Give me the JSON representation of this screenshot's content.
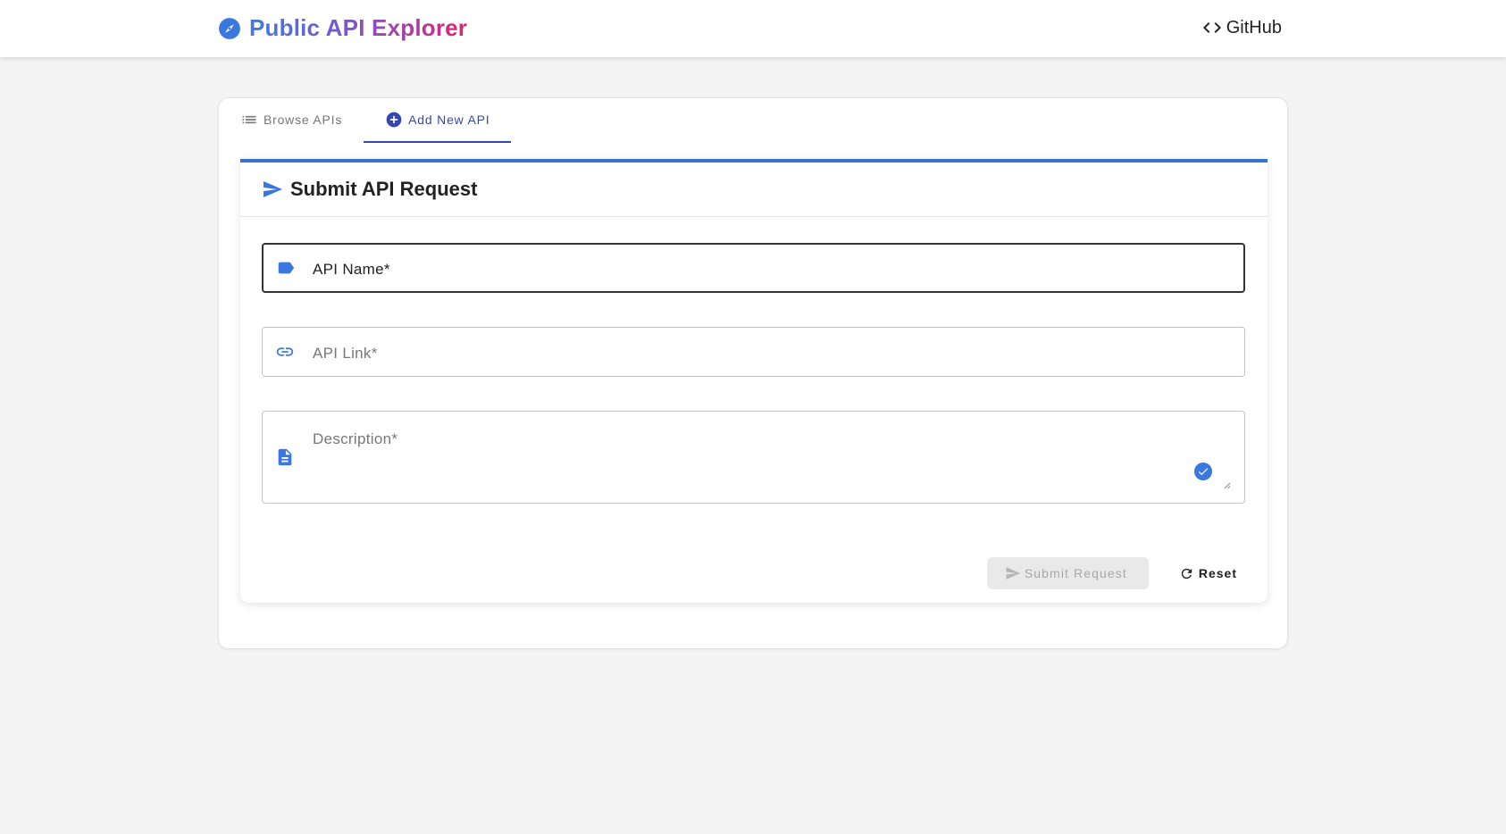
{
  "app": {
    "title": "Public API Explorer",
    "github_label": "GitHub"
  },
  "tabs": [
    {
      "label": "Browse APIs",
      "icon": "list-icon",
      "active": false
    },
    {
      "label": "Add New API",
      "icon": "add-circle-icon",
      "active": true
    }
  ],
  "form": {
    "title": "Submit API Request",
    "fields": {
      "name": {
        "label": "API Name*",
        "value": "",
        "icon": "label-tag-icon"
      },
      "link": {
        "label": "API Link*",
        "value": "",
        "icon": "link-icon"
      },
      "description": {
        "label": "Description*",
        "value": "",
        "icon": "document-icon"
      }
    },
    "submit_label": "Submit Request",
    "reset_label": "Reset"
  },
  "colors": {
    "primary": "#3a6fd2",
    "tab_active": "#3447b0",
    "brand_gradient": [
      "#3f7be0",
      "#8a4fc0",
      "#e0246e"
    ],
    "background": "#f4f4f4"
  }
}
